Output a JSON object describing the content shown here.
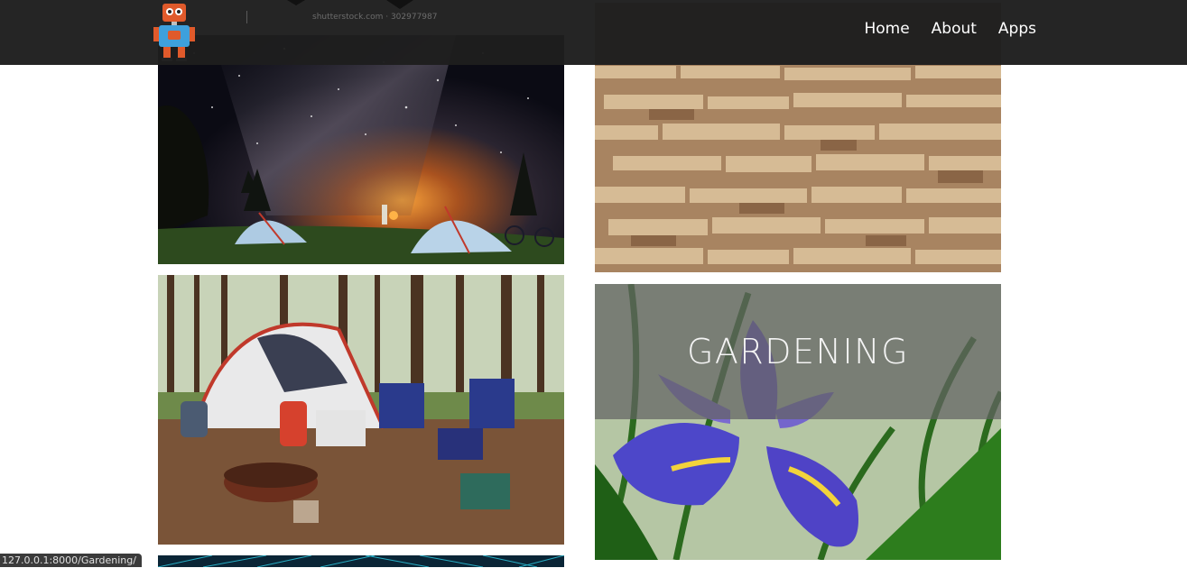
{
  "nav": {
    "watermark": "shutterstock.com · 302977987",
    "links": [
      "Home",
      "About",
      "Apps"
    ]
  },
  "tiles": {
    "gardening_title": "GARDENING"
  },
  "status_url": "127.0.0.1:8000/Gardening/",
  "colors": {
    "navbar": "#1e1e1e",
    "overlay": "#626262",
    "status": "#3b3b3b"
  },
  "icons": [
    "robot-logo-icon"
  ]
}
